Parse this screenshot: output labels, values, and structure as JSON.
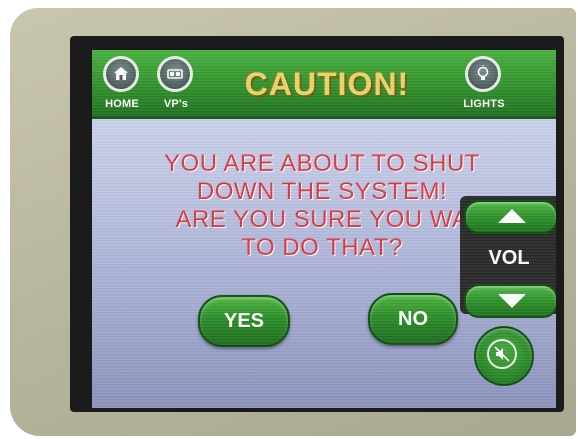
{
  "header": {
    "title": "CAUTION!",
    "buttons": [
      {
        "label": "HOME",
        "icon": "home-icon"
      },
      {
        "label": "VP's",
        "icon": "vp-icon"
      },
      {
        "label": "LIGHTS",
        "icon": "lightbulb-icon"
      }
    ]
  },
  "dialog": {
    "lines": [
      "YOU ARE ABOUT TO SHUT",
      "DOWN THE SYSTEM!",
      "ARE YOU SURE YOU WA",
      "TO DO THAT?"
    ],
    "yes_label": "YES",
    "no_label": "NO"
  },
  "volume": {
    "label": "VOL",
    "up_icon": "arrow-up-icon",
    "down_icon": "arrow-down-icon",
    "mute_icon": "mute-icon"
  },
  "colors": {
    "header_green": "#2f8f2a",
    "title_yellow": "#e7d86a",
    "message_red": "#d93a45",
    "button_green": "#2b8e28"
  }
}
